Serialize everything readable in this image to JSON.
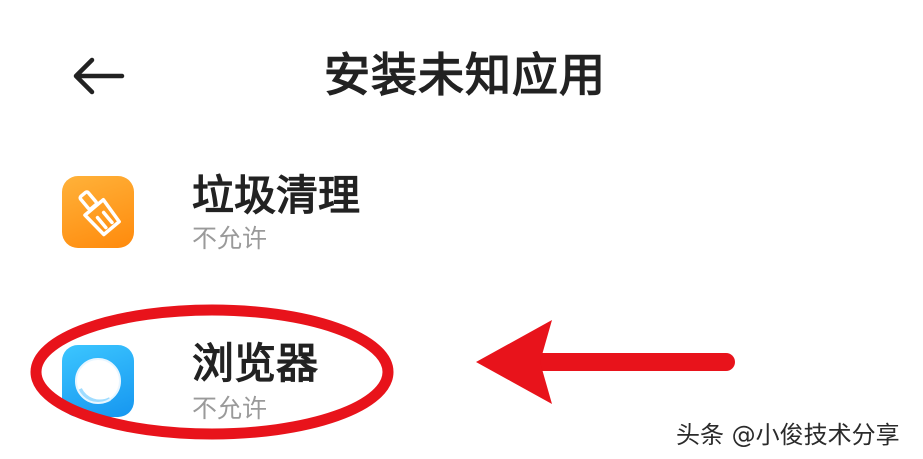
{
  "header": {
    "back_icon": "arrow-left-icon",
    "title": "安装未知应用"
  },
  "apps": [
    {
      "name": "垃圾清理",
      "status": "不允许",
      "icon": "broom-icon",
      "icon_color": "#ff9a1a"
    },
    {
      "name": "浏览器",
      "status": "不允许",
      "icon": "browser-icon",
      "icon_color": "#1fa8f5"
    }
  ],
  "annotation": {
    "color": "#e8131b",
    "shapes": [
      "ellipse",
      "arrow"
    ]
  },
  "watermark": {
    "text": "头条 @小俊技术分享"
  }
}
